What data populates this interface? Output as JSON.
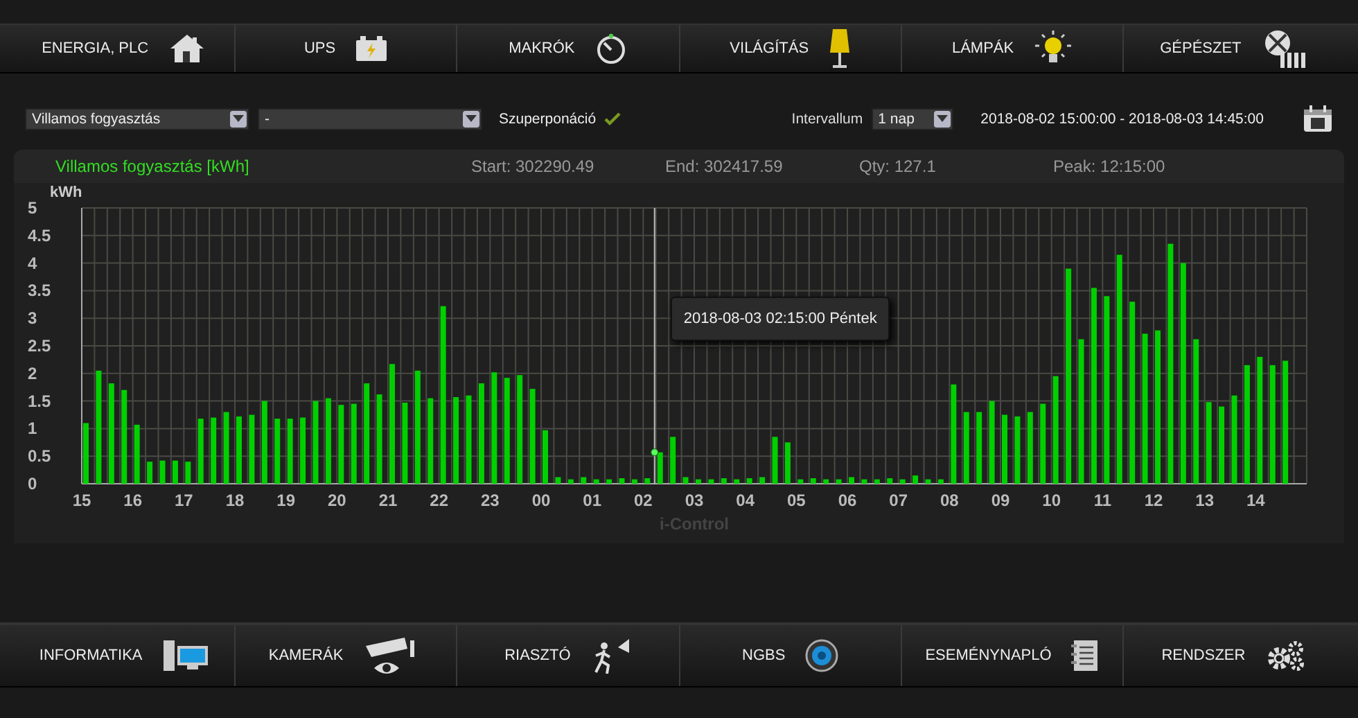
{
  "top_menu": [
    {
      "label": "ENERGIA, PLC"
    },
    {
      "label": "UPS"
    },
    {
      "label": "MAKRÓK"
    },
    {
      "label": "VILÁGÍTÁS"
    },
    {
      "label": "LÁMPÁK"
    },
    {
      "label": "GÉPÉSZET"
    }
  ],
  "filters": {
    "meter_select": {
      "value": "Villamos fogyasztás"
    },
    "compare_select": {
      "value": "-"
    },
    "overlay": {
      "label": "Szuperponáció",
      "checked": true
    },
    "interval_label": "Intervallum",
    "interval_select": {
      "value": "1 nap"
    },
    "date_range": "2018-08-02 15:00:00 - 2018-08-03 14:45:00"
  },
  "panel": {
    "title": "Villamos fogyasztás [kWh]",
    "stats": [
      "Start: 302290.49",
      "End: 302417.59",
      "Qty: 127.1",
      "Peak: 12:15:00"
    ]
  },
  "chart": {
    "credits": "i-Control",
    "chart_data": {
      "type": "bar",
      "ylabel": "kWh",
      "ylim": [
        0,
        5
      ],
      "grid": true,
      "yticks": [
        0,
        0.5,
        1,
        1.5,
        2,
        2.5,
        3,
        3.5,
        4,
        4.5,
        5
      ],
      "categories": [
        "15",
        null,
        null,
        null,
        "16",
        null,
        null,
        null,
        "17",
        null,
        null,
        null,
        "18",
        null,
        null,
        null,
        "19",
        null,
        null,
        null,
        "20",
        null,
        null,
        null,
        "21",
        null,
        null,
        null,
        "22",
        null,
        null,
        null,
        "23",
        null,
        null,
        null,
        "00",
        null,
        null,
        null,
        "01",
        null,
        null,
        null,
        "02",
        null,
        null,
        null,
        "03",
        null,
        null,
        null,
        "04",
        null,
        null,
        null,
        "05",
        null,
        null,
        null,
        "06",
        null,
        null,
        null,
        "07",
        null,
        null,
        null,
        "08",
        null,
        null,
        null,
        "09",
        null,
        null,
        null,
        "10",
        null,
        null,
        null,
        "11",
        null,
        null,
        null,
        "12",
        null,
        null,
        null,
        "13",
        null,
        null,
        null,
        "14",
        null,
        null
      ],
      "series": [
        {
          "color": "#00d000",
          "values": [
            1.1,
            2.05,
            1.82,
            1.7,
            1.07,
            0.4,
            0.42,
            0.42,
            0.4,
            1.18,
            1.2,
            1.3,
            1.22,
            1.25,
            1.5,
            1.18,
            1.18,
            1.2,
            1.5,
            1.55,
            1.43,
            1.45,
            1.82,
            1.62,
            2.17,
            1.47,
            2.05,
            1.55,
            3.22,
            1.57,
            1.6,
            1.82,
            2.02,
            1.92,
            1.97,
            1.72,
            0.97,
            0.12,
            0.08,
            0.12,
            0.08,
            0.08,
            0.1,
            0.08,
            0.1,
            0.57,
            0.85,
            0.12,
            0.08,
            0.08,
            0.1,
            0.08,
            0.1,
            0.12,
            0.85,
            0.75,
            0.08,
            0.1,
            0.08,
            0.08,
            0.12,
            0.08,
            0.08,
            0.1,
            0.08,
            0.15,
            0.08,
            0.08,
            1.8,
            1.3,
            1.3,
            1.5,
            1.25,
            1.22,
            1.3,
            1.45,
            1.95,
            3.9,
            2.62,
            3.55,
            3.4,
            4.15,
            3.3,
            2.72,
            2.78,
            4.35,
            4.0,
            2.62,
            1.48,
            1.4,
            1.6,
            2.15,
            2.3,
            2.15,
            2.23
          ]
        }
      ],
      "annotations": [
        "2018-08-03 02:15:00 Péntek"
      ]
    }
  },
  "bottom_menu": [
    {
      "label": "INFORMATIKA"
    },
    {
      "label": "KAMERÁK"
    },
    {
      "label": "RIASZTÓ"
    },
    {
      "label": "NGBS"
    },
    {
      "label": "ESEMÉNYNAPLÓ"
    },
    {
      "label": "RENDSZER"
    }
  ]
}
